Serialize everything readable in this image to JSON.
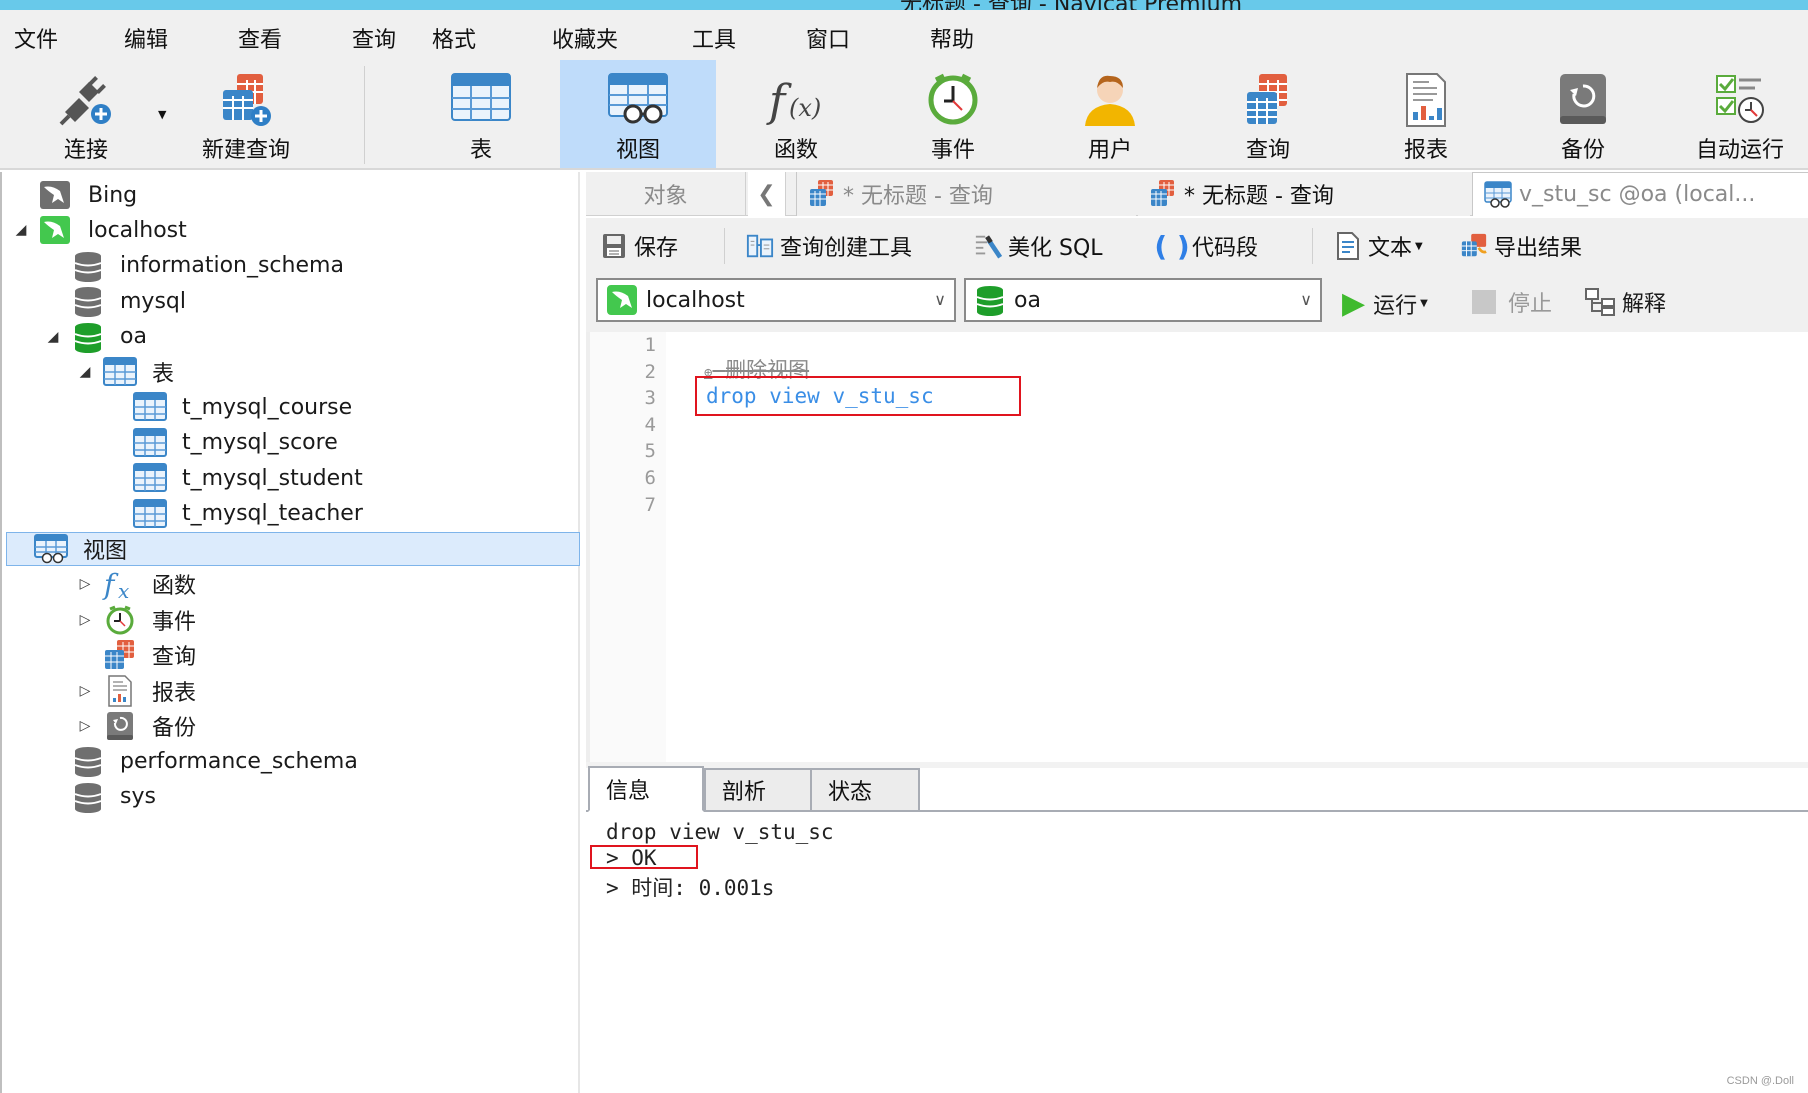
{
  "window": {
    "title": "无标题 - 查询 - Navicat Premium"
  },
  "menu": [
    "文件",
    "编辑",
    "查看",
    "查询",
    "格式",
    "收藏夹",
    "工具",
    "窗口",
    "帮助"
  ],
  "ribbon": {
    "buttons": [
      {
        "label": "连接",
        "icon": "connect-plug-icon"
      },
      {
        "label": "新建查询",
        "icon": "new-query-icon"
      },
      {
        "label": "表",
        "icon": "table-icon"
      },
      {
        "label": "视图",
        "icon": "view-icon",
        "active": true
      },
      {
        "label": "函数",
        "icon": "function-icon"
      },
      {
        "label": "事件",
        "icon": "event-clock-icon"
      },
      {
        "label": "用户",
        "icon": "user-icon"
      },
      {
        "label": "查询",
        "icon": "query-icon"
      },
      {
        "label": "报表",
        "icon": "report-icon"
      },
      {
        "label": "备份",
        "icon": "backup-icon"
      },
      {
        "label": "自动运行",
        "icon": "autorun-icon"
      }
    ]
  },
  "tree": {
    "nodes": [
      {
        "label": "Bing",
        "icon": "connection-gray-icon",
        "level": 0,
        "expander": ""
      },
      {
        "label": "localhost",
        "icon": "connection-green-icon",
        "level": 0,
        "expander": "◢"
      },
      {
        "label": "information_schema",
        "icon": "database-gray-icon",
        "level": 1,
        "expander": ""
      },
      {
        "label": "mysql",
        "icon": "database-gray-icon",
        "level": 1,
        "expander": ""
      },
      {
        "label": "oa",
        "icon": "database-green-icon",
        "level": 1,
        "expander": "◢"
      },
      {
        "label": "表",
        "icon": "table-icon",
        "level": 2,
        "expander": "◢"
      },
      {
        "label": "t_mysql_course",
        "icon": "table-icon",
        "level": 3,
        "expander": ""
      },
      {
        "label": "t_mysql_score",
        "icon": "table-icon",
        "level": 3,
        "expander": ""
      },
      {
        "label": "t_mysql_student",
        "icon": "table-icon",
        "level": 3,
        "expander": ""
      },
      {
        "label": "t_mysql_teacher",
        "icon": "table-icon",
        "level": 3,
        "expander": ""
      },
      {
        "label": "视图",
        "icon": "view-icon",
        "level": 2,
        "expander": "",
        "selected": true
      },
      {
        "label": "函数",
        "icon": "function-icon",
        "level": 2,
        "expander": "▷"
      },
      {
        "label": "事件",
        "icon": "event-clock-icon",
        "level": 2,
        "expander": "▷"
      },
      {
        "label": "查询",
        "icon": "query-icon",
        "level": 2,
        "expander": ""
      },
      {
        "label": "报表",
        "icon": "report-icon",
        "level": 2,
        "expander": "▷"
      },
      {
        "label": "备份",
        "icon": "backup-icon",
        "level": 2,
        "expander": "▷"
      },
      {
        "label": "performance_schema",
        "icon": "database-gray-icon",
        "level": 1,
        "expander": ""
      },
      {
        "label": "sys",
        "icon": "database-gray-icon",
        "level": 1,
        "expander": ""
      }
    ]
  },
  "doc_tabs": {
    "objects": "对象",
    "nav_back": "❮",
    "tabs": [
      {
        "label": "* 无标题 - 查询",
        "state": "inactive"
      },
      {
        "label": "* 无标题 - 查询",
        "state": "active"
      },
      {
        "label": "v_stu_sc @oa (local...",
        "state": "inactive"
      }
    ]
  },
  "query_toolbar": {
    "save": "保存",
    "query_builder": "查询创建工具",
    "beautify": "美化 SQL",
    "snippet": "代码段",
    "text": "文本",
    "export": "导出结果"
  },
  "connection_bar": {
    "connection": "localhost",
    "database": "oa",
    "run": "运行",
    "stop": "停止",
    "explain": "解释"
  },
  "editor": {
    "line_numbers": [
      "1",
      "2",
      "3",
      "4",
      "5",
      "6",
      "7"
    ],
    "comment_marker": "⊕",
    "comment": "删除视图",
    "sql_keyword": "drop view",
    "sql_ident": "v_stu_sc"
  },
  "results": {
    "tabs": [
      "信息",
      "剖析",
      "状态"
    ],
    "active_tab": "信息",
    "log": [
      "drop view v_stu_sc",
      "> OK",
      "> 时间: 0.001s"
    ]
  },
  "colors": {
    "titlebar": "#68c9ea",
    "active_ribbon": "#bfdcfa",
    "selection": "#dcebfc",
    "sql_keyword": "#3a8ee6",
    "highlight_box": "#e0141e",
    "run_green": "#3fba2e"
  },
  "watermark": "CSDN @.Doll"
}
